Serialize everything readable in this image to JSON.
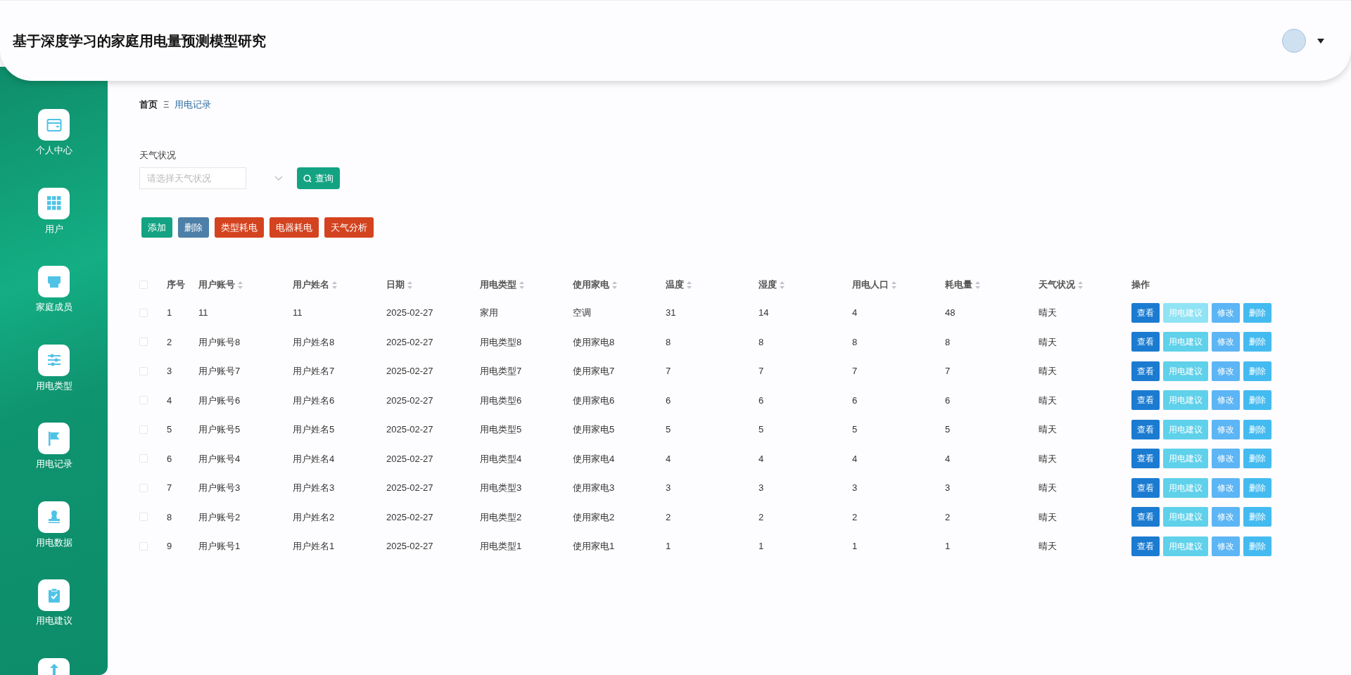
{
  "header": {
    "title": "基于深度学习的家庭用电量预测模型研究"
  },
  "sidebar": {
    "items": [
      {
        "label": "个人中心",
        "kind": "wallet"
      },
      {
        "label": "用户",
        "kind": "grid"
      },
      {
        "label": "家庭成员",
        "kind": "store"
      },
      {
        "label": "用电类型",
        "kind": "sliders"
      },
      {
        "label": "用电记录",
        "kind": "flag"
      },
      {
        "label": "用电数据",
        "kind": "stamp"
      },
      {
        "label": "用电建议",
        "kind": "clipboard"
      },
      {
        "kind": "chart"
      }
    ]
  },
  "breadcrumb": {
    "items": [
      "首页",
      "用电记录"
    ],
    "separator": "Ξ"
  },
  "filter": {
    "label": "天气状况",
    "placeholder": "请选择天气状况",
    "search_button": "查询"
  },
  "actions": [
    {
      "label": "添加",
      "kind": "green"
    },
    {
      "label": "删除",
      "kind": "steel"
    },
    {
      "label": "类型耗电",
      "kind": "red"
    },
    {
      "label": "电器耗电",
      "kind": "red"
    },
    {
      "label": "天气分析",
      "kind": "red"
    }
  ],
  "table": {
    "select_all_checked": false,
    "columns": [
      {
        "label": "序号",
        "sortable": false
      },
      {
        "label": "用户账号",
        "sortable": true
      },
      {
        "label": "用户姓名",
        "sortable": true
      },
      {
        "label": "日期",
        "sortable": true
      },
      {
        "label": "用电类型",
        "sortable": true
      },
      {
        "label": "使用家电",
        "sortable": true
      },
      {
        "label": "温度",
        "sortable": true
      },
      {
        "label": "湿度",
        "sortable": true
      },
      {
        "label": "用电人口",
        "sortable": true
      },
      {
        "label": "耗电量",
        "sortable": true
      },
      {
        "label": "天气状况",
        "sortable": true
      },
      {
        "label": "操作",
        "sortable": false
      }
    ],
    "rows": [
      {
        "checked": false,
        "cells": [
          "1",
          "11",
          "11",
          "2025-02-27",
          "家用",
          "空调",
          "31",
          "14",
          "4",
          "48",
          "晴天"
        ],
        "buttons": [
          {
            "label": "查看",
            "hovered": false
          },
          {
            "label": "用电建议",
            "hovered": true
          },
          {
            "label": "修改",
            "hovered": false
          },
          {
            "label": "删除",
            "hovered": false
          }
        ]
      },
      {
        "checked": false,
        "cells": [
          "2",
          "用户账号8",
          "用户姓名8",
          "2025-02-27",
          "用电类型8",
          "使用家电8",
          "8",
          "8",
          "8",
          "8",
          "晴天"
        ],
        "buttons": [
          {
            "label": "查看",
            "hovered": false
          },
          {
            "label": "用电建议",
            "hovered": false
          },
          {
            "label": "修改",
            "hovered": false
          },
          {
            "label": "删除",
            "hovered": false
          }
        ]
      },
      {
        "checked": false,
        "cells": [
          "3",
          "用户账号7",
          "用户姓名7",
          "2025-02-27",
          "用电类型7",
          "使用家电7",
          "7",
          "7",
          "7",
          "7",
          "晴天"
        ],
        "buttons": [
          {
            "label": "查看",
            "hovered": false
          },
          {
            "label": "用电建议",
            "hovered": false
          },
          {
            "label": "修改",
            "hovered": false
          },
          {
            "label": "删除",
            "hovered": false
          }
        ]
      },
      {
        "checked": false,
        "cells": [
          "4",
          "用户账号6",
          "用户姓名6",
          "2025-02-27",
          "用电类型6",
          "使用家电6",
          "6",
          "6",
          "6",
          "6",
          "晴天"
        ],
        "buttons": [
          {
            "label": "查看",
            "hovered": false
          },
          {
            "label": "用电建议",
            "hovered": false
          },
          {
            "label": "修改",
            "hovered": false
          },
          {
            "label": "删除",
            "hovered": false
          }
        ]
      },
      {
        "checked": false,
        "cells": [
          "5",
          "用户账号5",
          "用户姓名5",
          "2025-02-27",
          "用电类型5",
          "使用家电5",
          "5",
          "5",
          "5",
          "5",
          "晴天"
        ],
        "buttons": [
          {
            "label": "查看",
            "hovered": false
          },
          {
            "label": "用电建议",
            "hovered": false
          },
          {
            "label": "修改",
            "hovered": false
          },
          {
            "label": "删除",
            "hovered": false
          }
        ]
      },
      {
        "checked": false,
        "cells": [
          "6",
          "用户账号4",
          "用户姓名4",
          "2025-02-27",
          "用电类型4",
          "使用家电4",
          "4",
          "4",
          "4",
          "4",
          "晴天"
        ],
        "buttons": [
          {
            "label": "查看",
            "hovered": false
          },
          {
            "label": "用电建议",
            "hovered": false
          },
          {
            "label": "修改",
            "hovered": false
          },
          {
            "label": "删除",
            "hovered": false
          }
        ]
      },
      {
        "checked": false,
        "cells": [
          "7",
          "用户账号3",
          "用户姓名3",
          "2025-02-27",
          "用电类型3",
          "使用家电3",
          "3",
          "3",
          "3",
          "3",
          "晴天"
        ],
        "buttons": [
          {
            "label": "查看",
            "hovered": false
          },
          {
            "label": "用电建议",
            "hovered": false
          },
          {
            "label": "修改",
            "hovered": false
          },
          {
            "label": "删除",
            "hovered": false
          }
        ]
      },
      {
        "checked": false,
        "cells": [
          "8",
          "用户账号2",
          "用户姓名2",
          "2025-02-27",
          "用电类型2",
          "使用家电2",
          "2",
          "2",
          "2",
          "2",
          "晴天"
        ],
        "buttons": [
          {
            "label": "查看",
            "hovered": false
          },
          {
            "label": "用电建议",
            "hovered": false
          },
          {
            "label": "修改",
            "hovered": false
          },
          {
            "label": "删除",
            "hovered": false
          }
        ]
      },
      {
        "checked": false,
        "cells": [
          "9",
          "用户账号1",
          "用户姓名1",
          "2025-02-27",
          "用电类型1",
          "使用家电1",
          "1",
          "1",
          "1",
          "1",
          "晴天"
        ],
        "buttons": [
          {
            "label": "查看",
            "hovered": false
          },
          {
            "label": "用电建议",
            "hovered": false
          },
          {
            "label": "修改",
            "hovered": false
          },
          {
            "label": "删除",
            "hovered": false
          }
        ]
      }
    ]
  }
}
